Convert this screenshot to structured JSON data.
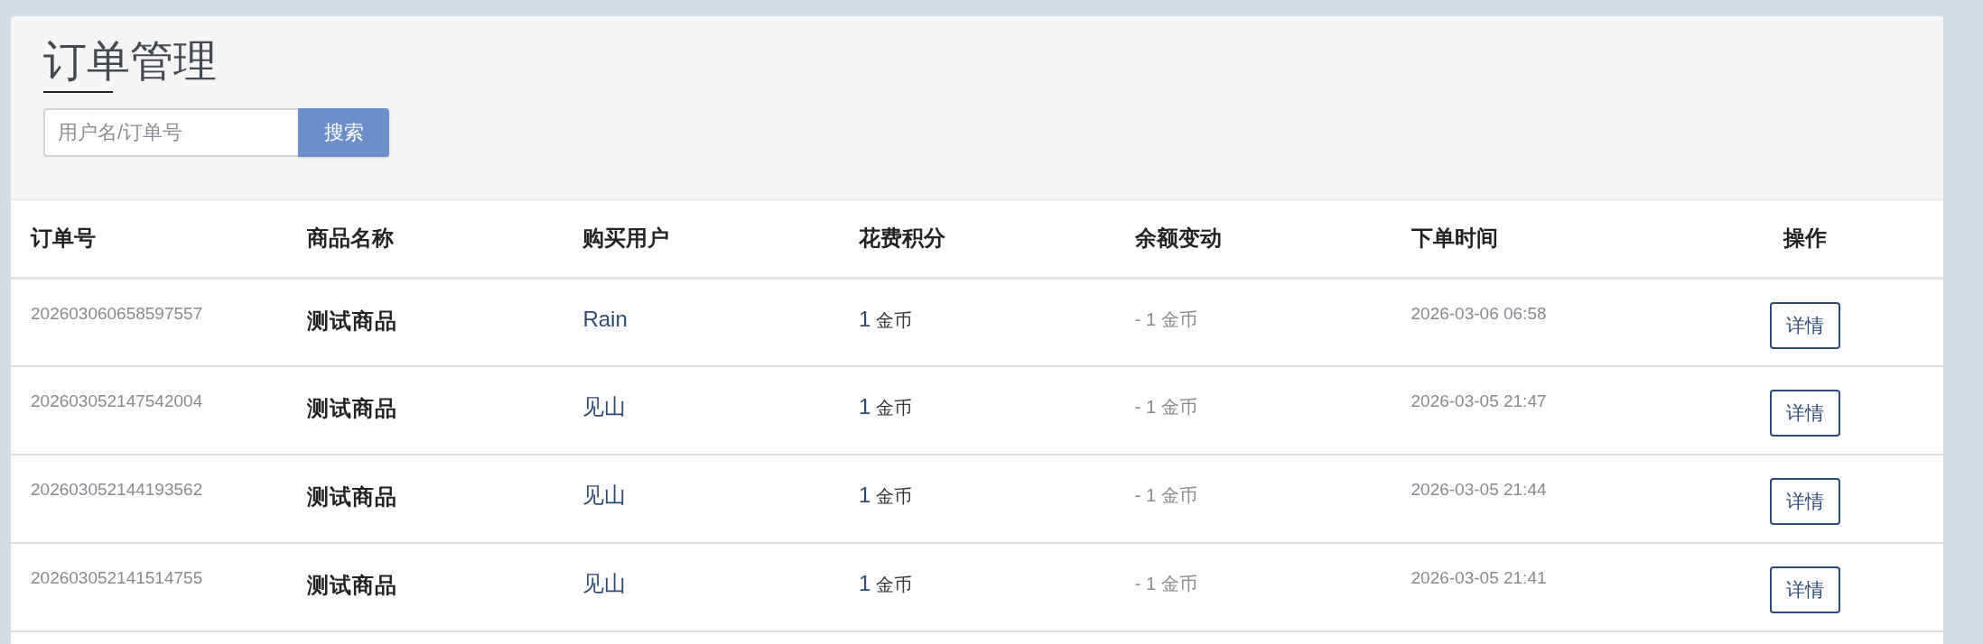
{
  "page": {
    "title": "订单管理"
  },
  "search": {
    "placeholder": "用户名/订单号",
    "button": "搜索"
  },
  "table": {
    "columns": [
      "订单号",
      "商品名称",
      "购买用户",
      "花费积分",
      "余额变动",
      "下单时间",
      "操作"
    ],
    "rows": [
      {
        "order_no": "202603060658597557",
        "product": "测试商品",
        "user": "Rain",
        "points": {
          "amount": "1",
          "unit": "金币"
        },
        "balance_change": "- 1 金币",
        "time": "2026-03-06 06:58",
        "action": "详情"
      },
      {
        "order_no": "202603052147542004",
        "product": "测试商品",
        "user": "见山",
        "points": {
          "amount": "1",
          "unit": "金币"
        },
        "balance_change": "- 1 金币",
        "time": "2026-03-05 21:47",
        "action": "详情"
      },
      {
        "order_no": "202603052144193562",
        "product": "测试商品",
        "user": "见山",
        "points": {
          "amount": "1",
          "unit": "金币"
        },
        "balance_change": "- 1 金币",
        "time": "2026-03-05 21:44",
        "action": "详情"
      },
      {
        "order_no": "202603052141514755",
        "product": "测试商品",
        "user": "见山",
        "points": {
          "amount": "1",
          "unit": "金币"
        },
        "balance_change": "- 1 金币",
        "time": "2026-03-05 21:41",
        "action": "详情"
      }
    ]
  }
}
